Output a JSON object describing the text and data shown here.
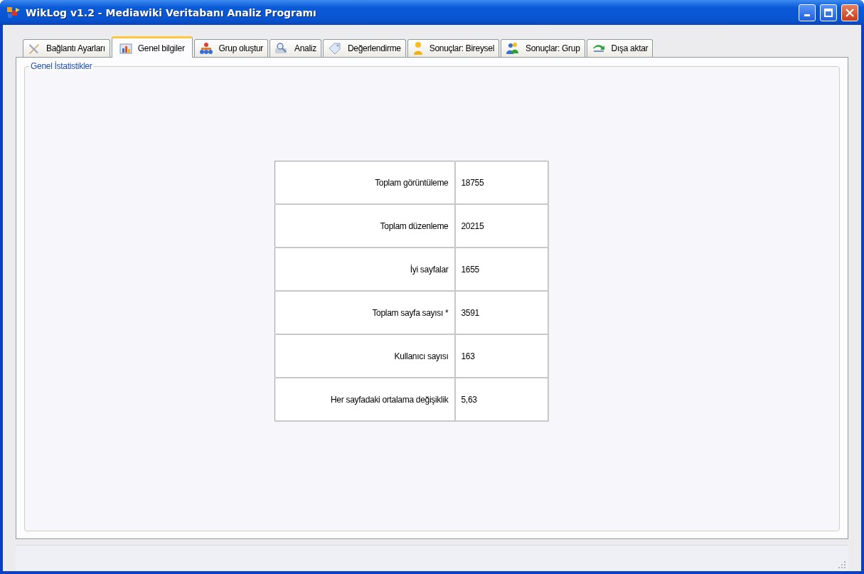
{
  "window": {
    "title": "WikLog v1.2 - Mediawiki Veritabanı Analiz Programı"
  },
  "tabs": [
    {
      "label": "Bağlantı Ayarları",
      "selected": false
    },
    {
      "label": "Genel bilgiler",
      "selected": true
    },
    {
      "label": "Grup oluştur",
      "selected": false
    },
    {
      "label": "Analiz",
      "selected": false
    },
    {
      "label": "Değerlendirme",
      "selected": false
    },
    {
      "label": "Sonuçlar: Bireysel",
      "selected": false
    },
    {
      "label": "Sonuçlar: Grup",
      "selected": false
    },
    {
      "label": "Dışa aktar",
      "selected": false
    }
  ],
  "group": {
    "title": "Genel İstatistikler"
  },
  "table": {
    "rows": [
      {
        "label": "Toplam görüntüleme",
        "value": "18755"
      },
      {
        "label": "Toplam düzenleme",
        "value": "20215"
      },
      {
        "label": "İyi sayfalar",
        "value": "1655"
      },
      {
        "label": "Toplam sayfa sayısı *",
        "value": "3591"
      },
      {
        "label": "Kullanıcı sayısı",
        "value": "163"
      },
      {
        "label": "Her sayfadaki ortalama değişiklik",
        "value": "5,63"
      }
    ]
  }
}
